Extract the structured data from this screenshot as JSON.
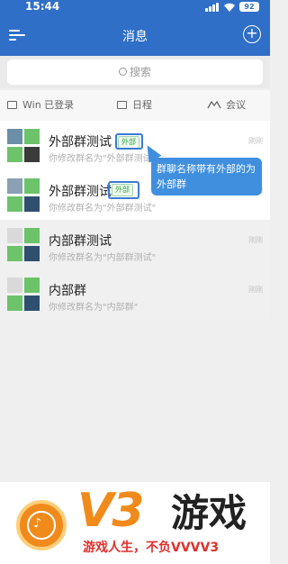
{
  "status": {
    "time": "15:44",
    "battery": "92"
  },
  "header": {
    "title": "消息"
  },
  "search": {
    "placeholder": "搜索"
  },
  "quick": [
    {
      "label": "Win 已登录",
      "icon": "monitor-icon"
    },
    {
      "label": "日程",
      "icon": "calendar-icon"
    },
    {
      "label": "会议",
      "icon": "meeting-icon"
    }
  ],
  "chats": [
    {
      "name": "外部群测试",
      "tag": "外部",
      "preview": "你修改群名为\"外部群测试\"",
      "time": "刚刚"
    },
    {
      "name": "外部群测试",
      "tag": "外部",
      "preview": "你修改群名为\"外部群测试\"",
      "time": "刚刚"
    },
    {
      "name": "内部群测试",
      "preview": "你修改群名为\"内部群测试\"",
      "time": "刚刚"
    },
    {
      "name": "内部群",
      "preview": "你修改群名为\"内部群\"",
      "time": "刚刚"
    }
  ],
  "callout": {
    "text": "群聊名称带有外部的为外部群"
  },
  "watermark": {
    "brand": "V3",
    "brand_cn": "游戏",
    "slogan": "游戏人生，不负VVVV3"
  },
  "colors": {
    "accent": "#2f6fc8",
    "tag_green": "#35a34a",
    "highlight_blue": "#3a7bd5",
    "brand_orange": "#f08a1b",
    "slogan_red": "#e0302c"
  }
}
